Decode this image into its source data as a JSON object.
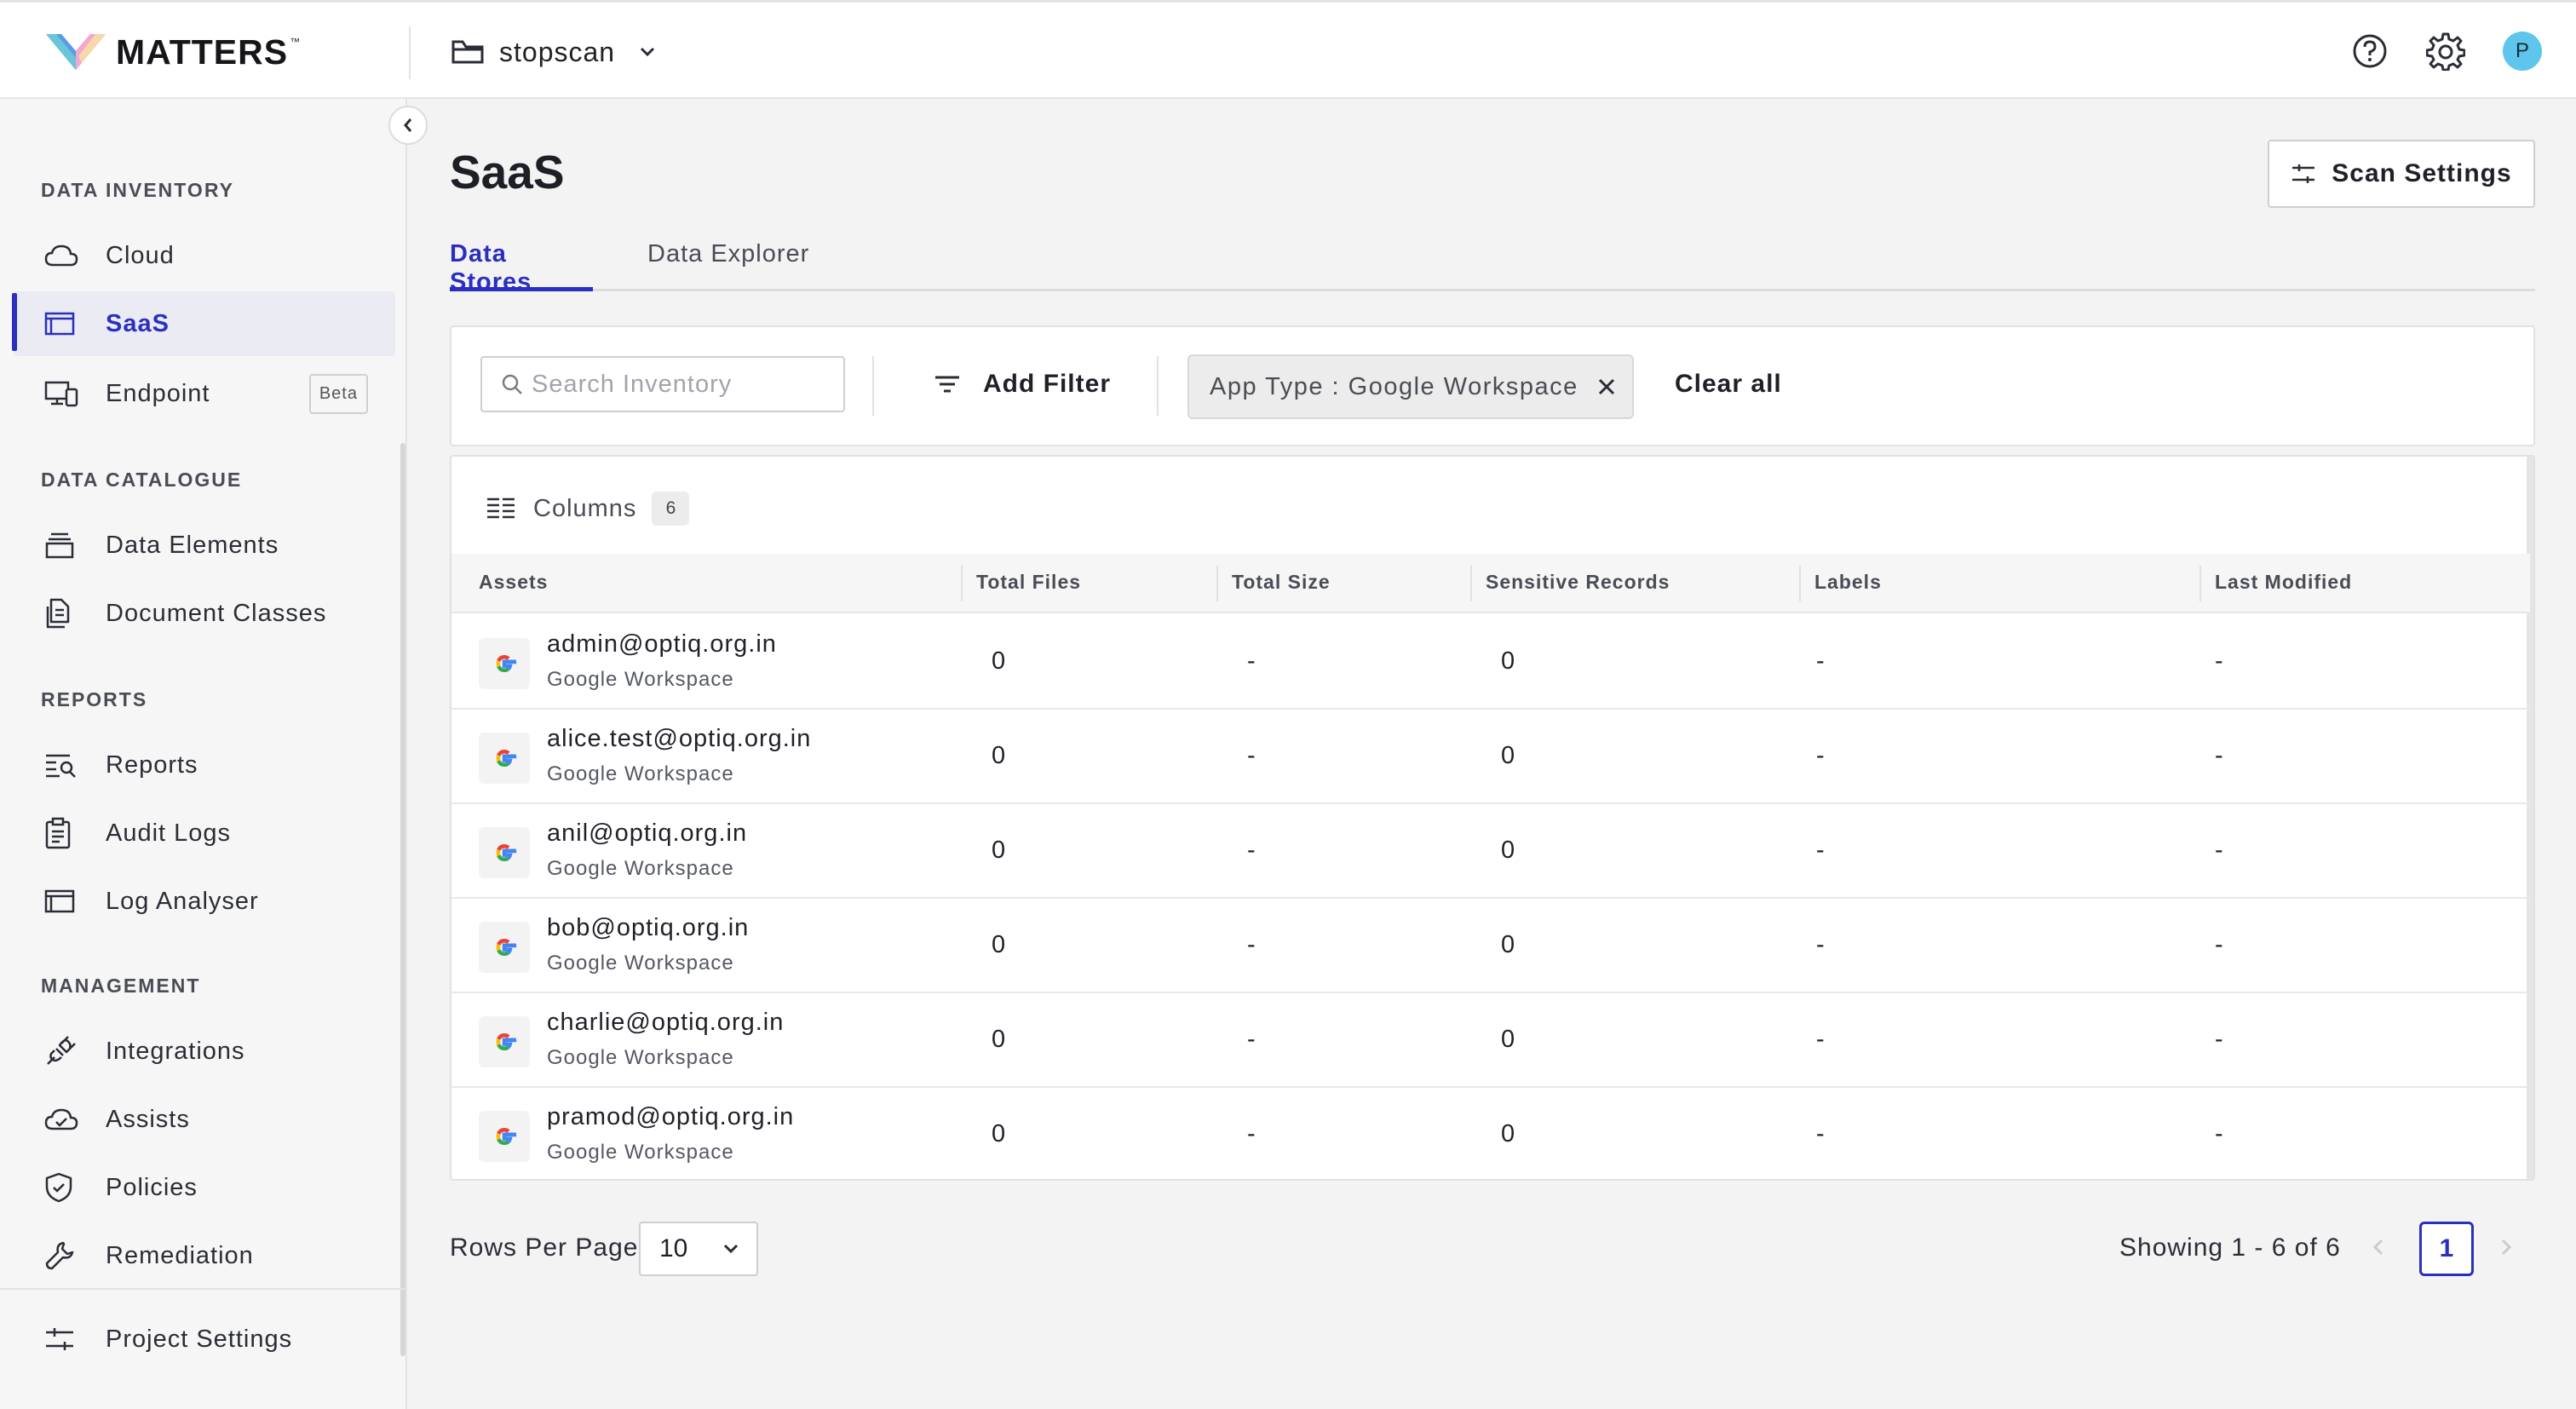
{
  "app": {
    "logo_text": "MATTERS",
    "logo_tm": "™",
    "project_name": "stopscan",
    "avatar_initial": "P"
  },
  "sidebar": {
    "sections": [
      {
        "title": "DATA INVENTORY",
        "items": [
          {
            "label": "Cloud",
            "icon": "cloud-icon"
          },
          {
            "label": "SaaS",
            "icon": "window-icon",
            "active": true
          },
          {
            "label": "Endpoint",
            "icon": "devices-icon",
            "badge": "Beta"
          }
        ]
      },
      {
        "title": "DATA CATALOGUE",
        "items": [
          {
            "label": "Data Elements",
            "icon": "stack-icon"
          },
          {
            "label": "Document Classes",
            "icon": "document-icon"
          }
        ]
      },
      {
        "title": "REPORTS",
        "items": [
          {
            "label": "Reports",
            "icon": "report-search-icon"
          },
          {
            "label": "Audit Logs",
            "icon": "clipboard-icon"
          },
          {
            "label": "Log Analyser",
            "icon": "window-icon"
          }
        ]
      },
      {
        "title": "MANAGEMENT",
        "items": [
          {
            "label": "Integrations",
            "icon": "plug-icon"
          },
          {
            "label": "Assists",
            "icon": "cloud-check-icon"
          },
          {
            "label": "Policies",
            "icon": "shield-check-icon"
          },
          {
            "label": "Remediation",
            "icon": "wrench-icon"
          }
        ]
      }
    ],
    "footer_item": {
      "label": "Project Settings",
      "icon": "sliders-icon"
    }
  },
  "page": {
    "title": "SaaS",
    "scan_settings_label": "Scan Settings",
    "tabs": [
      {
        "label": "Data Stores",
        "active": true
      },
      {
        "label": "Data Explorer",
        "active": false
      }
    ]
  },
  "filters": {
    "search_placeholder": "Search Inventory",
    "search_value": "",
    "add_filter_label": "Add Filter",
    "chip_label": "App Type : Google Workspace",
    "clear_all_label": "Clear all"
  },
  "table": {
    "columns_label": "Columns",
    "columns_count": "6",
    "headers": [
      "Assets",
      "Total Files",
      "Total Size",
      "Sensitive Records",
      "Labels",
      "Last Modified"
    ],
    "rows": [
      {
        "name": "admin@optiq.org.in",
        "type": "Google Workspace",
        "total_files": "0",
        "total_size": "-",
        "sensitive_records": "0",
        "labels": "-",
        "last_modified": "-"
      },
      {
        "name": "alice.test@optiq.org.in",
        "type": "Google Workspace",
        "total_files": "0",
        "total_size": "-",
        "sensitive_records": "0",
        "labels": "-",
        "last_modified": "-"
      },
      {
        "name": "anil@optiq.org.in",
        "type": "Google Workspace",
        "total_files": "0",
        "total_size": "-",
        "sensitive_records": "0",
        "labels": "-",
        "last_modified": "-"
      },
      {
        "name": "bob@optiq.org.in",
        "type": "Google Workspace",
        "total_files": "0",
        "total_size": "-",
        "sensitive_records": "0",
        "labels": "-",
        "last_modified": "-"
      },
      {
        "name": "charlie@optiq.org.in",
        "type": "Google Workspace",
        "total_files": "0",
        "total_size": "-",
        "sensitive_records": "0",
        "labels": "-",
        "last_modified": "-"
      },
      {
        "name": "pramod@optiq.org.in",
        "type": "Google Workspace",
        "total_files": "0",
        "total_size": "-",
        "sensitive_records": "0",
        "labels": "-",
        "last_modified": "-"
      }
    ]
  },
  "pagination": {
    "rows_per_page_label": "Rows Per Page",
    "rows_per_page_value": "10",
    "showing_text": "Showing 1 - 6 of 6",
    "current_page": "1"
  },
  "colors": {
    "accent": "#2a2fc0",
    "avatar_bg": "#5ec5ec"
  }
}
